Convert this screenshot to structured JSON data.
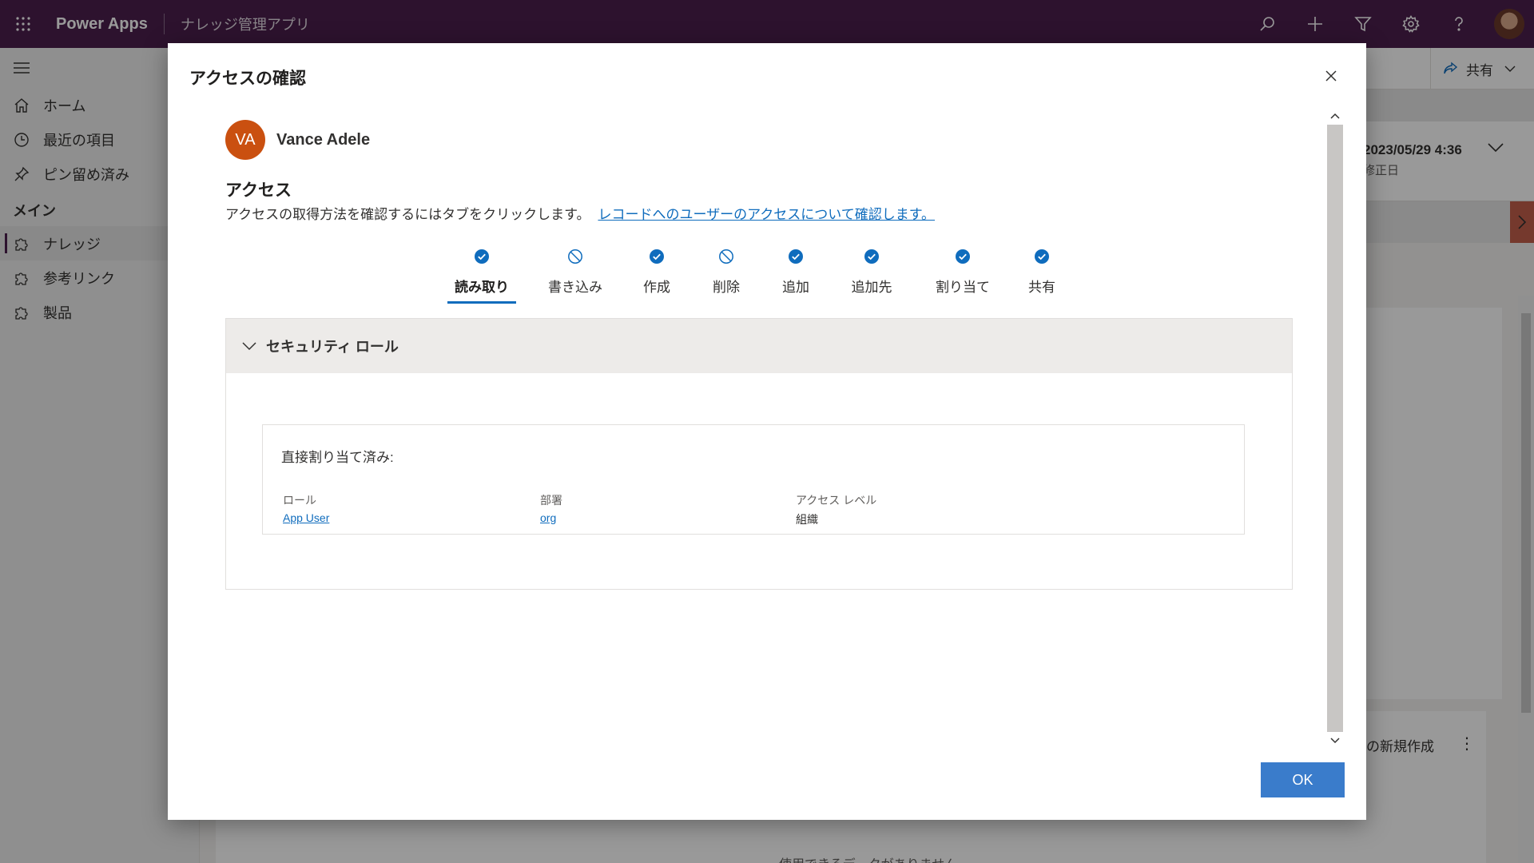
{
  "topbar": {
    "app_name": "Power Apps",
    "app_sub": "ナレッジ管理アプリ",
    "icons": [
      "waffle-icon",
      "search-icon",
      "add-icon",
      "filter-icon",
      "settings-icon",
      "help-icon"
    ]
  },
  "sidebar": {
    "items": [
      {
        "label": "ホーム",
        "icon": "home-icon"
      },
      {
        "label": "最近の項目",
        "icon": "clock-icon"
      },
      {
        "label": "ピン留め済み",
        "icon": "pin-icon"
      }
    ],
    "group_label": "メイン",
    "group_items": [
      {
        "label": "ナレッジ",
        "icon": "puzzle-icon",
        "active": true
      },
      {
        "label": "参考リンク",
        "icon": "puzzle-icon"
      },
      {
        "label": "製品",
        "icon": "puzzle-icon"
      }
    ]
  },
  "background": {
    "share_label": "共有",
    "modified_date": "2023/05/29 4:36",
    "modified_label": "修正日",
    "new_label": "の新規作成",
    "nodata_label": "使用できるデータがありません"
  },
  "dialog": {
    "title": "アクセスの確認",
    "user": {
      "initials": "VA",
      "name": "Vance Adele"
    },
    "access_heading": "アクセス",
    "access_desc": "アクセスの取得方法を確認するにはタブをクリックします。",
    "access_link": "レコードへのユーザーのアクセスについて確認します。",
    "tabs": [
      {
        "label": "読み取り",
        "status": "allowed",
        "active": true
      },
      {
        "label": "書き込み",
        "status": "denied"
      },
      {
        "label": "作成",
        "status": "allowed"
      },
      {
        "label": "削除",
        "status": "denied"
      },
      {
        "label": "追加",
        "status": "allowed"
      },
      {
        "label": "追加先",
        "status": "allowed"
      },
      {
        "label": "割り当て",
        "status": "allowed"
      },
      {
        "label": "共有",
        "status": "allowed"
      }
    ],
    "section": {
      "title": "セキュリティ ロール",
      "card_title": "直接割り当て済み:",
      "columns": [
        {
          "header": "ロール",
          "value": "App User",
          "link": true
        },
        {
          "header": "部署",
          "value": "org",
          "link": true
        },
        {
          "header": "アクセス レベル",
          "value": "組織",
          "link": false
        }
      ]
    },
    "ok_label": "OK"
  },
  "colors": {
    "topbar": "#4b1f4e",
    "accent": "#0f6cbd",
    "avatar": "#ca5010",
    "ok_button": "#3a7ccb"
  }
}
